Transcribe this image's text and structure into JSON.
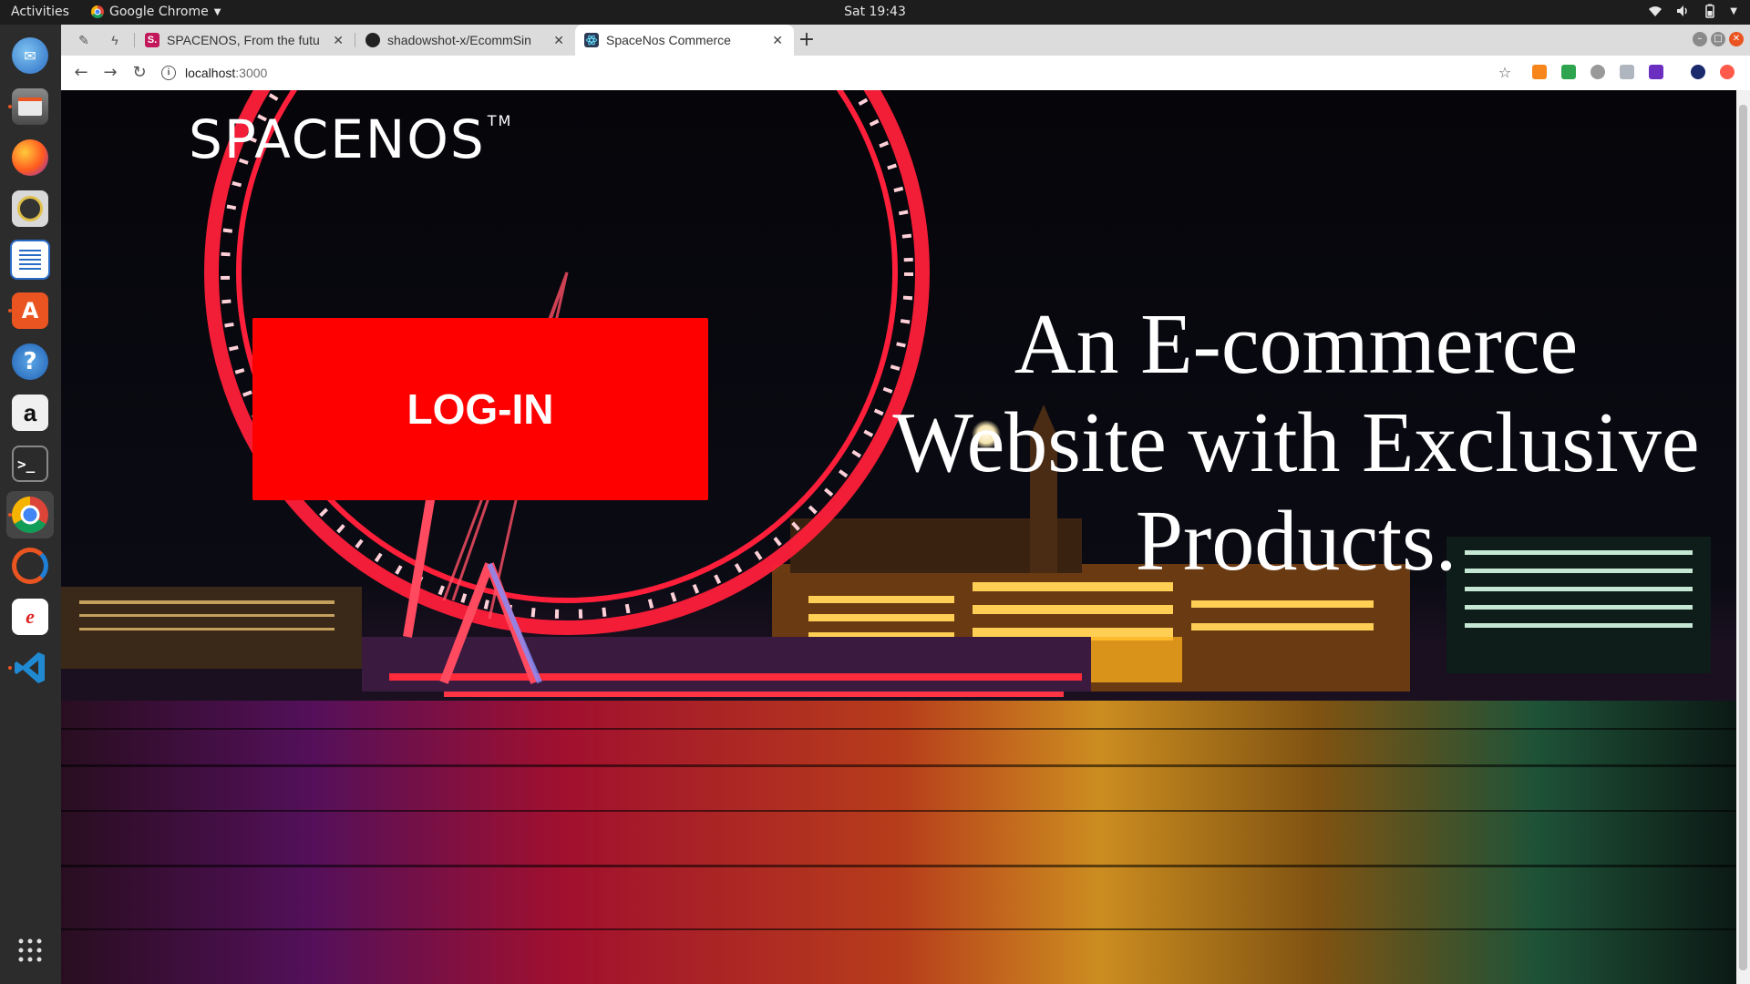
{
  "topbar": {
    "activities": "Activities",
    "app_name": "Google Chrome",
    "clock": "Sat 19:43"
  },
  "dock": {
    "apps": [
      "thunderbird-icon",
      "files-icon",
      "firefox-icon",
      "rhythmbox-icon",
      "writer-icon",
      "software-icon",
      "help-icon",
      "amazon-icon",
      "terminal-icon",
      "chrome-icon",
      "ubuntu-icon",
      "editor-icon",
      "vscode-icon",
      "app-grid-icon"
    ]
  },
  "browser": {
    "tabs": [
      {
        "title": "SPACENOS, From the futu",
        "favicon_text": "S."
      },
      {
        "title": "shadowshot-x/EcommSin",
        "favicon_text": ""
      },
      {
        "title": "SpaceNos Commerce",
        "favicon_text": ""
      }
    ],
    "url_host": "localhost",
    "url_port": ":3000",
    "colors": {
      "tabstrip": "#dcdcdc",
      "toolbar": "#ffffff"
    }
  },
  "page": {
    "brand": "SPACENOS",
    "brand_mark": "TM",
    "login_label": "LOG-IN",
    "tagline_lines": [
      "An E-commerce",
      "Website with Exclusive",
      "Products."
    ],
    "colors": {
      "login_bg": "#ff0000",
      "text": "#ffffff",
      "wheel": "#ff1f3a"
    }
  }
}
